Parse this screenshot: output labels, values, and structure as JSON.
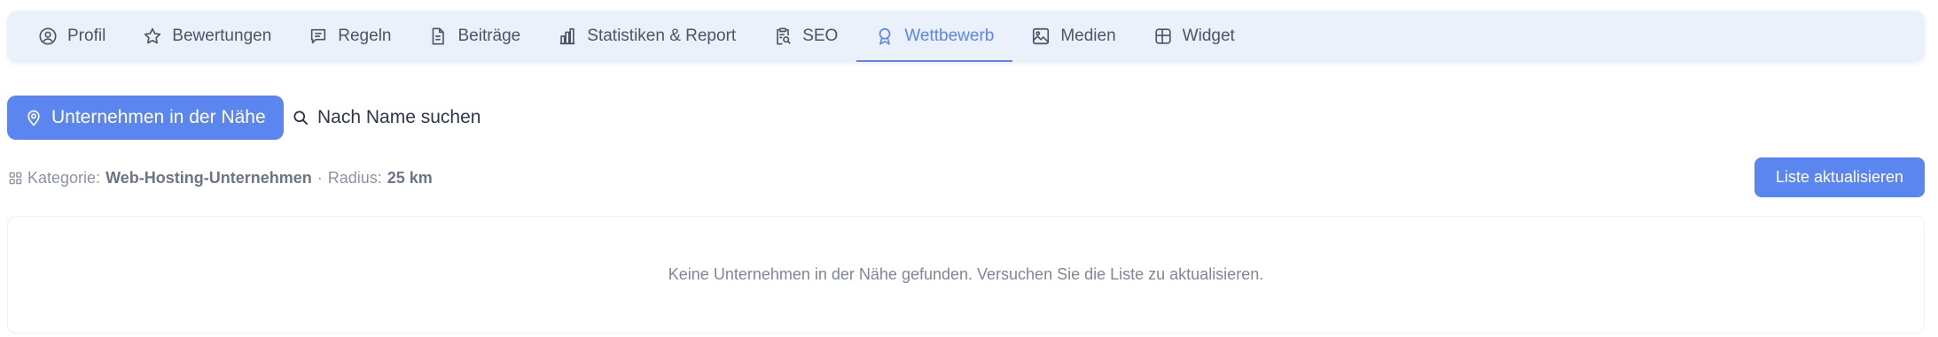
{
  "tabs": [
    {
      "label": "Profil",
      "icon": "user-circle-icon",
      "active": false
    },
    {
      "label": "Bewertungen",
      "icon": "star-icon",
      "active": false
    },
    {
      "label": "Regeln",
      "icon": "message-icon",
      "active": false
    },
    {
      "label": "Beiträge",
      "icon": "document-icon",
      "active": false
    },
    {
      "label": "Statistiken & Report",
      "icon": "bar-chart-icon",
      "active": false
    },
    {
      "label": "SEO",
      "icon": "clipboard-search-icon",
      "active": false
    },
    {
      "label": "Wettbewerb",
      "icon": "award-icon",
      "active": true
    },
    {
      "label": "Medien",
      "icon": "image-icon",
      "active": false
    },
    {
      "label": "Widget",
      "icon": "layout-icon",
      "active": false
    }
  ],
  "search_modes": {
    "nearby_label": "Unternehmen in der Nähe",
    "by_name_label": "Nach Name suchen"
  },
  "filters": {
    "category_label": "Kategorie:",
    "category_value": "Web-Hosting-Unternehmen",
    "separator": "·",
    "radius_label": "Radius:",
    "radius_value": "25 km"
  },
  "refresh_label": "Liste aktualisieren",
  "empty_message": "Keine Unternehmen in der Nähe gefunden. Versuchen Sie die Liste zu aktualisieren.",
  "colors": {
    "accent": "#5b86f0",
    "tab_bar_bg": "#eaf1fb",
    "text": "#4a5568",
    "muted": "#8a94a6"
  }
}
